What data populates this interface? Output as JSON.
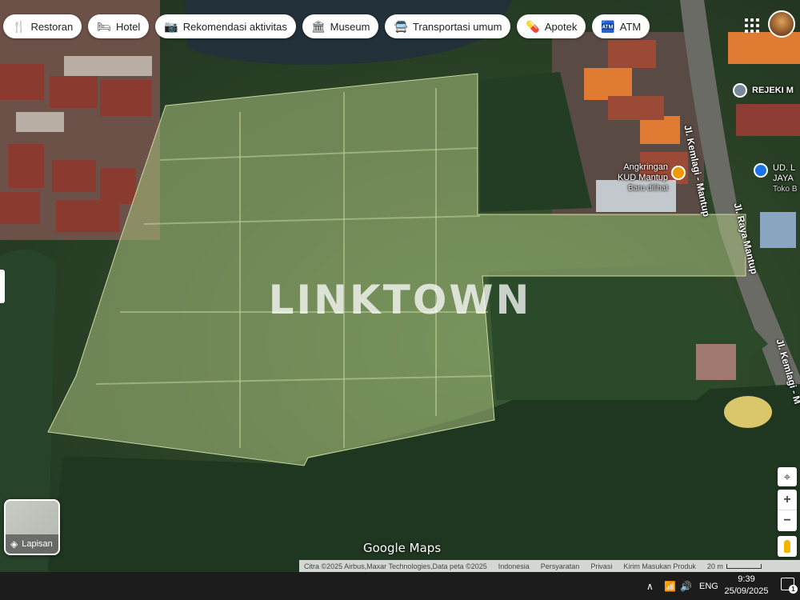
{
  "chips": [
    {
      "label": "Restoran",
      "icon": "fork-knife-icon",
      "glyph": "🍴"
    },
    {
      "label": "Hotel",
      "icon": "bed-icon",
      "glyph": "🛏"
    },
    {
      "label": "Rekomendasi aktivitas",
      "icon": "camera-icon",
      "glyph": "📷"
    },
    {
      "label": "Museum",
      "icon": "museum-icon",
      "glyph": "🏛"
    },
    {
      "label": "Transportasi umum",
      "icon": "bus-icon",
      "glyph": "🚍"
    },
    {
      "label": "Apotek",
      "icon": "pharmacy-icon",
      "glyph": "💊"
    },
    {
      "label": "ATM",
      "icon": "atm-icon",
      "glyph": "🏧"
    }
  ],
  "roads": {
    "kemlagi_mantup_1": "Jl. Kemlagi - Mantup",
    "raya_mantup": "Jl. Raya Mantup",
    "kemlagi_mantup_2": "Jl. Kemlagi - M"
  },
  "pois": {
    "rejeki": "REJEKI M",
    "angkringan_line1": "Angkringan",
    "angkringan_line2": "KUD Mantup",
    "angkringan_sub": "Baru dilihat",
    "ud_line1": "UD. L",
    "ud_line2": "JAYA",
    "ud_sub": "Toko B"
  },
  "watermark": "LINKTOWN",
  "layers_label": "Lapisan",
  "google_logo": "Google Maps",
  "attribution": {
    "imagery": "Citra ©2025 Airbus,Maxar Technologies,Data peta ©2025",
    "country": "Indonesia",
    "terms": "Persyaratan",
    "privacy": "Privasi",
    "feedback": "Kirim Masukan Produk",
    "scale": "20 m"
  },
  "taskbar": {
    "language": "ENG",
    "time": "9:39",
    "date": "25/09/2025",
    "notifications": "1"
  },
  "colors": {
    "parcel_overlay": "#a8c07e",
    "poi_orange": "#f29900",
    "poi_blue": "#1a73e8",
    "poi_gray": "#7a8a99"
  }
}
